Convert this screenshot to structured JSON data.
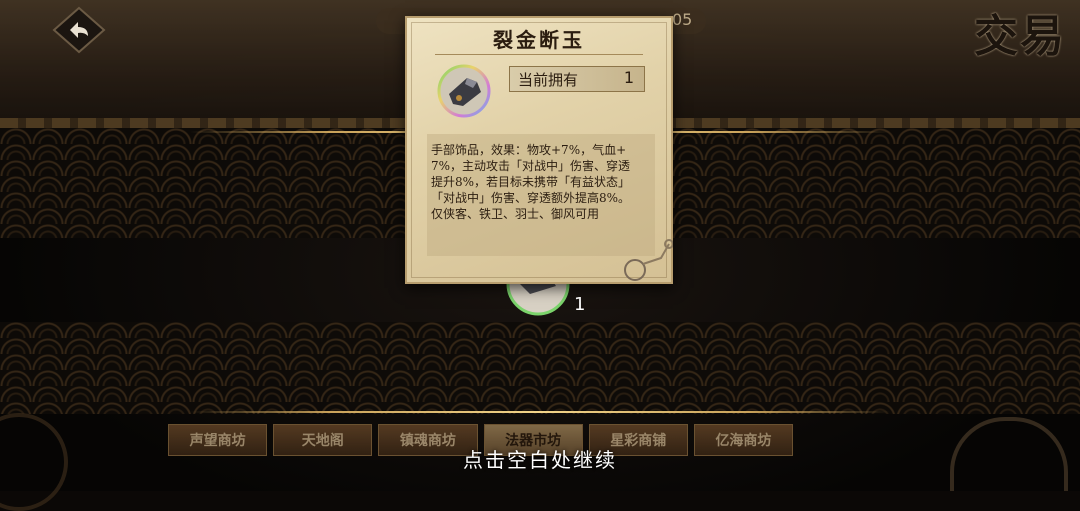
{
  "header": {
    "title": "交易",
    "resource_value": "05"
  },
  "item_card": {
    "name": "裂金断玉",
    "owned_label": "当前拥有",
    "owned_count": "1",
    "description": "手部饰品，效果：物攻+7%，气血+7%，主动攻击「对战中」伤害、穿透提升8%，若目标未携带「有益状态」「对战中」伤害、穿透额外提高8%。仅侠客、铁卫、羽士、御风可用",
    "icon": "gauntlet-icon"
  },
  "behind_item": {
    "count": "1"
  },
  "shop_tabs": [
    {
      "label": "声望商坊",
      "active": false
    },
    {
      "label": "天地阁",
      "active": false
    },
    {
      "label": "镇魂商坊",
      "active": false
    },
    {
      "label": "法器市坊",
      "active": true
    },
    {
      "label": "星彩商铺",
      "active": false
    },
    {
      "label": "亿海商坊",
      "active": false
    }
  ],
  "prompt": "点击空白处继续",
  "colors": {
    "gold": "#f3d58a",
    "parchment": "#e2d2a9",
    "text_dark": "#2b1d10"
  }
}
